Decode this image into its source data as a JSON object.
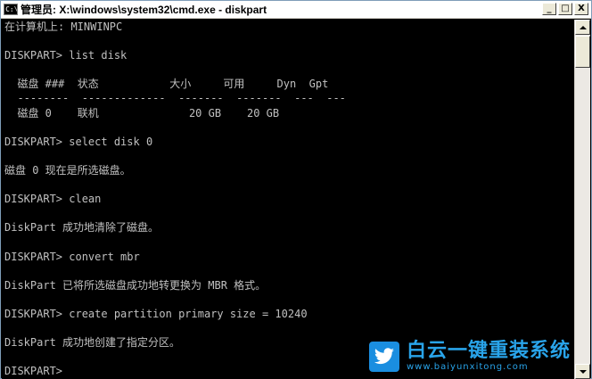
{
  "window": {
    "title": "管理员: X:\\windows\\system32\\cmd.exe - diskpart",
    "icon_label": "C:\\",
    "controls": {
      "minimize": "_",
      "maximize": "□",
      "close": "X"
    }
  },
  "console": {
    "lines": [
      "在计算机上: MINWINPC",
      "",
      "DISKPART> list disk",
      "",
      "  磁盘 ###  状态           大小     可用     Dyn  Gpt",
      "  --------  -------------  -------  -------  ---  ---",
      "  磁盘 0    联机              20 GB    20 GB",
      "",
      "DISKPART> select disk 0",
      "",
      "磁盘 0 现在是所选磁盘。",
      "",
      "DISKPART> clean",
      "",
      "DiskPart 成功地清除了磁盘。",
      "",
      "DISKPART> convert mbr",
      "",
      "DiskPart 已将所选磁盘成功地转更换为 MBR 格式。",
      "",
      "DISKPART> create partition primary size = 10240",
      "",
      "DiskPart 成功地创建了指定分区。",
      "",
      "DISKPART>"
    ]
  },
  "watermark": {
    "title": "白云一键重装系统",
    "url": "www.baiyunxitong.com",
    "color": "#29a4ea",
    "icon": "twitter-bird-icon"
  },
  "colors": {
    "console_bg": "#000000",
    "console_fg": "#c0c0c0",
    "titlebar_bg": "#ffffff"
  }
}
